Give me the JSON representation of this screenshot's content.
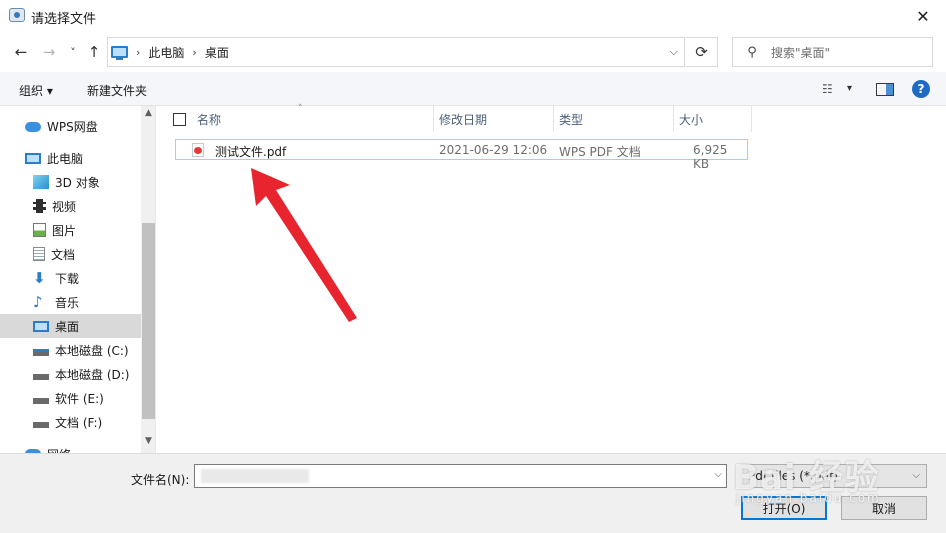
{
  "window": {
    "title": "请选择文件",
    "close_glyph": "✕"
  },
  "address_bar": {
    "back_glyph": "←",
    "forward_glyph": "→",
    "recent_glyph": "˅",
    "up_glyph": "↑",
    "crumb_separator": "›",
    "crumbs": [
      "此电脑",
      "桌面"
    ],
    "dropdown_glyph": "⌵",
    "refresh_glyph": "⟳",
    "search_icon_glyph": "⚲",
    "search_placeholder": "搜索\"桌面\""
  },
  "toolbar": {
    "organize_label": "组织 ▾",
    "new_folder_label": "新建文件夹",
    "view_glyph": "☷",
    "view_dropdown_glyph": "▾",
    "help_glyph": "?"
  },
  "sidebar": {
    "items": [
      {
        "label": "WPS网盘",
        "icon": "cloud-icon"
      },
      {
        "label": "此电脑",
        "icon": "computer-icon"
      },
      {
        "label": "3D 对象",
        "icon": "3d-objects-icon"
      },
      {
        "label": "视频",
        "icon": "video-icon"
      },
      {
        "label": "图片",
        "icon": "picture-icon"
      },
      {
        "label": "文档",
        "icon": "document-icon"
      },
      {
        "label": "下载",
        "icon": "download-icon"
      },
      {
        "label": "音乐",
        "icon": "music-icon"
      },
      {
        "label": "桌面",
        "icon": "desktop-icon",
        "selected": true
      },
      {
        "label": "本地磁盘 (C:)",
        "icon": "drive-c-icon"
      },
      {
        "label": "本地磁盘 (D:)",
        "icon": "drive-icon"
      },
      {
        "label": "软件 (E:)",
        "icon": "drive-icon"
      },
      {
        "label": "文档 (F:)",
        "icon": "drive-icon"
      },
      {
        "label": "网络",
        "icon": "network-icon"
      }
    ],
    "scroll_up_glyph": "▲",
    "scroll_down_glyph": "▼"
  },
  "file_list": {
    "sort_glyph": "˄",
    "columns": [
      "名称",
      "修改日期",
      "类型",
      "大小"
    ],
    "rows": [
      {
        "name": "测试文件.pdf",
        "modified": "2021-06-29 12:06",
        "type": "WPS PDF 文档",
        "size": "6,925 KB"
      }
    ]
  },
  "bottom": {
    "filename_label": "文件名(N):",
    "filename_value": "",
    "filetype_value": "Pdf files (*.pdf)",
    "open_label": "打开(O)",
    "cancel_label": "取消",
    "dropdown_glyph": "⌵"
  },
  "watermark": {
    "text": "Bai 经验",
    "sub": "jingyan.baidu.com"
  },
  "colors": {
    "accent": "#0078d7",
    "selection_border": "#99d1ff",
    "annotation_arrow": "#e8242e"
  }
}
